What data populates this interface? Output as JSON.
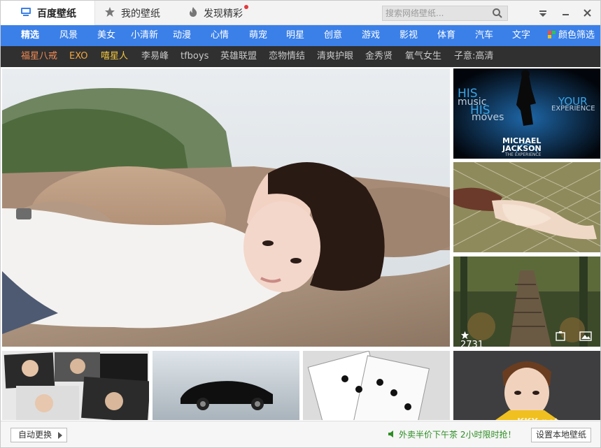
{
  "title_tabs": [
    {
      "label": "百度壁纸",
      "icon": "monitor-icon"
    },
    {
      "label": "我的壁纸",
      "icon": "star-icon"
    },
    {
      "label": "发现精彩",
      "icon": "flame-icon",
      "badge": true
    }
  ],
  "search": {
    "placeholder": "搜索网络壁纸..."
  },
  "categories": [
    "精选",
    "风景",
    "美女",
    "小清新",
    "动漫",
    "心情",
    "萌宠",
    "明星",
    "创意",
    "游戏",
    "影视",
    "体育",
    "汽车",
    "文字"
  ],
  "active_category": "精选",
  "color_filter": {
    "label": "颜色筛选",
    "icon": "color-grid-icon"
  },
  "tags": [
    {
      "label": "福星八戒",
      "color": "#f08a54"
    },
    {
      "label": "EXO",
      "color": "#f0a640"
    },
    {
      "label": "嘻星人",
      "color": "#f3c63c"
    },
    {
      "label": "李易峰",
      "color": "#c8c8c8"
    },
    {
      "label": "tfboys",
      "color": "#c8c8c8"
    },
    {
      "label": "英雄联盟",
      "color": "#c8c8c8"
    },
    {
      "label": "恋物情结",
      "color": "#c8c8c8"
    },
    {
      "label": "清爽护眼",
      "color": "#c8c8c8"
    },
    {
      "label": "金秀贤",
      "color": "#c8c8c8"
    },
    {
      "label": "氧气女生",
      "color": "#c8c8c8"
    },
    {
      "label": "子意:高清",
      "color": "#c8c8c8"
    }
  ],
  "tiles": {
    "mj": {
      "line1": "HIS",
      "line2": "music",
      "line3": "HIS",
      "line4": "moves",
      "right1": "YOUR",
      "right2": "EXPERIENCE",
      "logo1": "MICHAEL",
      "logo2": "JACKSON",
      "logo3": "THE EXPERIENCE"
    },
    "forest": {
      "likes": "2731"
    }
  },
  "footer": {
    "auto_change": "自动更换",
    "promo": "外卖半价下午茶  2小时限时抢！",
    "set_local": "设置本地壁纸"
  },
  "watermark": "KKX.net",
  "colors": {
    "accent": "#3b80e8",
    "tagbar": "#303030",
    "promo": "#2c8d22"
  }
}
